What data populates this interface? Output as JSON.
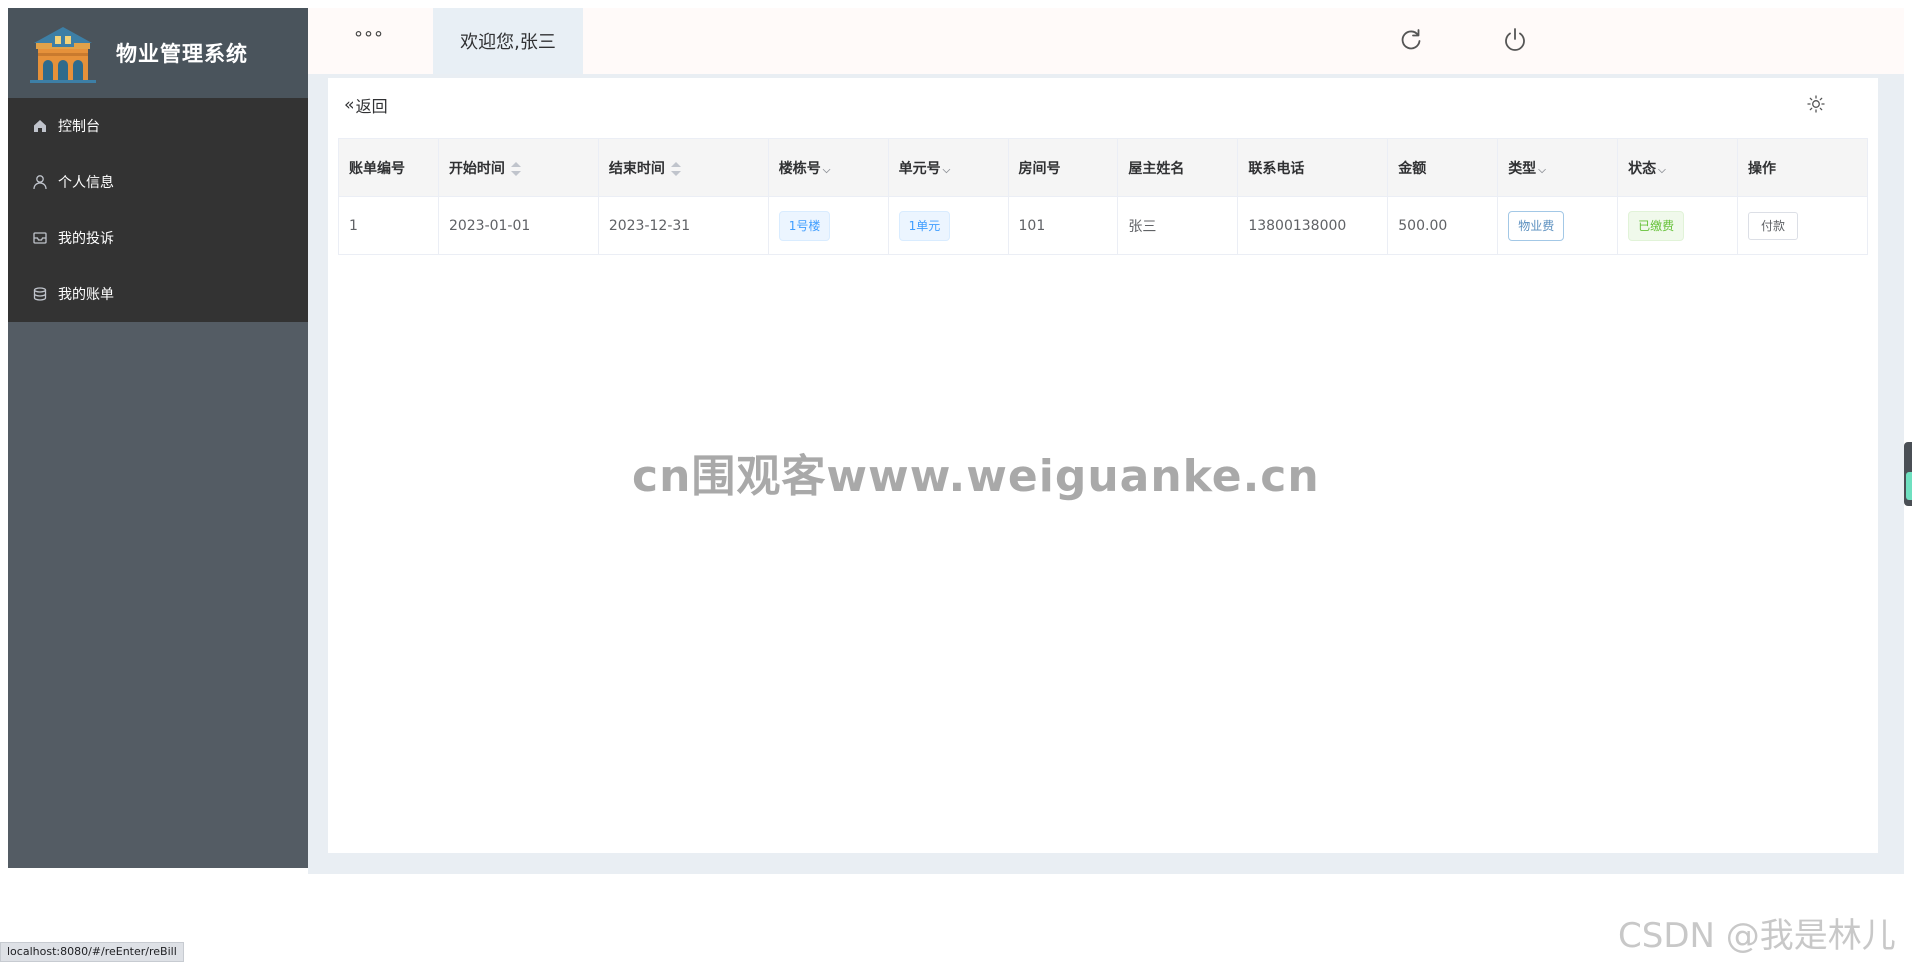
{
  "app": {
    "title": "物业管理系统",
    "logo_icon": "building-logo-icon"
  },
  "sidebar": {
    "items": [
      {
        "label": "控制台",
        "icon": "home-icon"
      },
      {
        "label": "个人信息",
        "icon": "user-icon"
      },
      {
        "label": "我的投诉",
        "icon": "inbox-icon"
      },
      {
        "label": "我的账单",
        "icon": "coins-icon"
      }
    ]
  },
  "header": {
    "more_label": "°°°",
    "welcome": "欢迎您,张三",
    "refresh_icon": "refresh-icon",
    "power_icon": "power-icon"
  },
  "main": {
    "back_label": "返回",
    "theme_icon": "sun-icon"
  },
  "table": {
    "columns": [
      "账单编号",
      "开始时间",
      "结束时间",
      "楼栋号",
      "单元号",
      "房间号",
      "屋主姓名",
      "联系电话",
      "金额",
      "类型",
      "状态",
      "操作"
    ],
    "rows": [
      {
        "id": "1",
        "start": "2023-01-01",
        "end": "2023-12-31",
        "building": "1号楼",
        "unit": "1单元",
        "room": "101",
        "owner": "张三",
        "phone": "13800138000",
        "amount": "500.00",
        "type": "物业费",
        "status": "已缴费",
        "action": "付款"
      }
    ]
  },
  "overlays": {
    "watermark": "cn围观客www.weiguanke.cn",
    "status_url": "localhost:8080/#/reEnter/reBill",
    "credit": "CSDN @我是林儿"
  },
  "colors": {
    "sidebar_bg": "#545c64",
    "menu_bg": "#333333",
    "header_bg": "#fffaf9",
    "tab_active_bg": "#e8eff5",
    "main_bg": "#e9eef3",
    "tag_blue": "#409eff",
    "tag_green": "#67c23a"
  }
}
